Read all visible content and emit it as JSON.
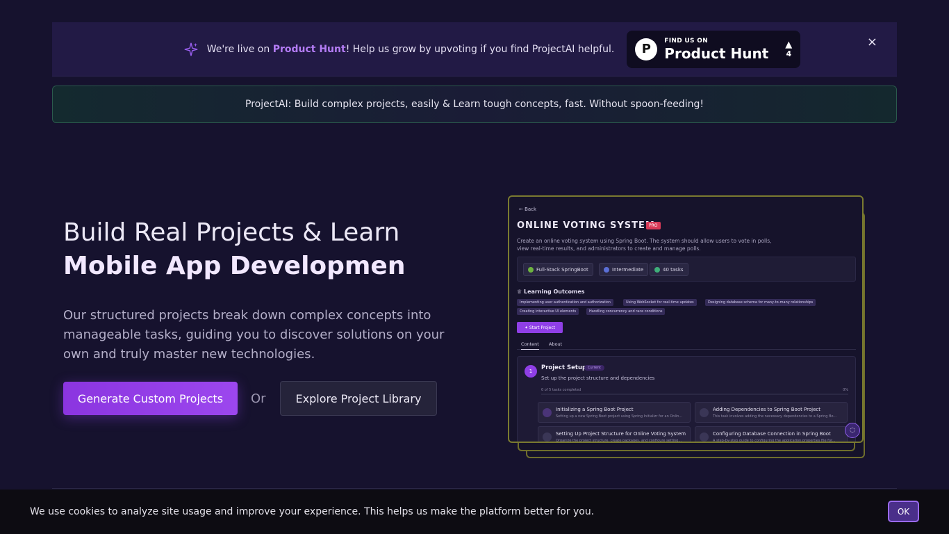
{
  "promo": {
    "prefix": "We're live on ",
    "link": "Product Hunt",
    "suffix": "! Help us grow by upvoting if you find ProjectAI helpful.",
    "badge_small": "FIND US ON",
    "badge_big": "Product Hunt",
    "badge_logo": "P",
    "badge_votes": "4",
    "close_icon": "×"
  },
  "tagline": "ProjectAI: Build complex projects, easily & Learn tough concepts, fast. Without spoon-feeding!",
  "hero": {
    "title_line1": "Build Real Projects & Learn",
    "title_line2": "Mobile App Developmen",
    "description": "Our structured projects break down complex concepts into manageable tasks, guiding you to discover solutions on your own and truly master new technologies.",
    "primary_button": "Generate Custom Projects",
    "or_text": "Or",
    "secondary_button": "Explore Project Library"
  },
  "preview": {
    "back": "← Back",
    "title": "ONLINE VOTING SYSTEM",
    "badge": "PRO",
    "description": "Create an online voting system using Spring Boot. The system should allow users to vote in polls, view real-time results, and administrators to create and manage polls.",
    "chips": [
      "Full-Stack SpringBoot",
      "Intermediate",
      "40 tasks"
    ],
    "outcomes_title": "Learning Outcomes",
    "outcomes": [
      "Implementing user authentication and authorization",
      "Using WebSocket for real-time updates",
      "Designing database schema for many-to-many relationships",
      "Creating interactive UI elements",
      "Handling concurrency and race conditions"
    ],
    "start_button": "Start Project",
    "tabs": [
      "Content",
      "About"
    ],
    "step_number": "1",
    "step_title": "Project Setup",
    "step_status": "Current",
    "step_subtitle": "Set up the project structure and dependencies",
    "progress_text": "0 of 5 tasks completed",
    "progress_pct": "0%",
    "tasks": [
      {
        "title": "Initializing a Spring Boot Project",
        "desc": "Setting up a new Spring Boot project using Spring Initializr for an Onlin..."
      },
      {
        "title": "Adding Dependencies to Spring Boot Project",
        "desc": "This task involves adding the necessary dependencies to a Spring Bo..."
      },
      {
        "title": "Setting Up Project Structure for Online Voting System",
        "desc": "Organize the project structure, create packages, and configure setting..."
      },
      {
        "title": "Configuring Database Connection in Spring Boot",
        "desc": "A step-by-step guide to configuring the application.properties file for..."
      }
    ]
  },
  "cookie": {
    "text": "We use cookies to analyze site usage and improve your experience. This helps us make the platform better for you.",
    "ok": "OK"
  },
  "colors": {
    "background": "#16122e",
    "accent": "#9c47ee",
    "link": "#b47cf5"
  }
}
